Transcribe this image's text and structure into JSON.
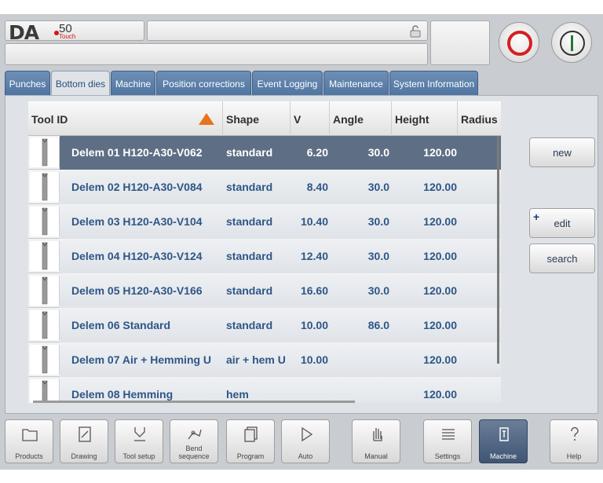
{
  "header": {
    "logo_brand": "DA",
    "logo_model": "50",
    "logo_sub": "Touch"
  },
  "tabs": [
    {
      "label": "Punches",
      "active": false
    },
    {
      "label": "Bottom dies",
      "active": true
    },
    {
      "label": "Machine",
      "active": false
    },
    {
      "label": "Position corrections",
      "active": false
    },
    {
      "label": "Event Logging",
      "active": false
    },
    {
      "label": "Maintenance",
      "active": false
    },
    {
      "label": "System Information",
      "active": false
    }
  ],
  "table": {
    "columns": [
      "Tool ID",
      "Shape",
      "V",
      "Angle",
      "Height",
      "Radius"
    ],
    "sort_column": "Tool ID",
    "rows": [
      {
        "id": "Delem 01 H120-A30-V062",
        "shape": "standard",
        "v": "6.20",
        "angle": "30.0",
        "height": "120.00",
        "radius": "",
        "selected": true
      },
      {
        "id": "Delem 02 H120-A30-V084",
        "shape": "standard",
        "v": "8.40",
        "angle": "30.0",
        "height": "120.00",
        "radius": ""
      },
      {
        "id": "Delem 03 H120-A30-V104",
        "shape": "standard",
        "v": "10.40",
        "angle": "30.0",
        "height": "120.00",
        "radius": ""
      },
      {
        "id": "Delem 04 H120-A30-V124",
        "shape": "standard",
        "v": "12.40",
        "angle": "30.0",
        "height": "120.00",
        "radius": ""
      },
      {
        "id": "Delem 05 H120-A30-V166",
        "shape": "standard",
        "v": "16.60",
        "angle": "30.0",
        "height": "120.00",
        "radius": ""
      },
      {
        "id": "Delem 06 Standard",
        "shape": "standard",
        "v": "10.00",
        "angle": "86.0",
        "height": "120.00",
        "radius": ""
      },
      {
        "id": "Delem 07 Air + Hemming U",
        "shape": "air + hem U",
        "v": "10.00",
        "angle": "",
        "height": "120.00",
        "radius": ""
      },
      {
        "id": "Delem 08 Hemming",
        "shape": "hem",
        "v": "",
        "angle": "",
        "height": "120.00",
        "radius": ""
      }
    ]
  },
  "side_buttons": {
    "new": "new",
    "edit": "edit",
    "edit_plus": "+",
    "search": "search"
  },
  "bottom_bar": [
    {
      "label": "Products",
      "icon": "folder-icon"
    },
    {
      "label": "Drawing",
      "icon": "drawing-icon"
    },
    {
      "label": "Tool setup",
      "icon": "tool-setup-icon"
    },
    {
      "label": "Bend sequence",
      "icon": "bend-sequence-icon"
    },
    {
      "label": "Program",
      "icon": "program-icon"
    },
    {
      "label": "Auto",
      "icon": "play-icon"
    },
    {
      "label": "Manual",
      "icon": "hand-icon"
    },
    {
      "label": "Settings",
      "icon": "settings-list-icon"
    },
    {
      "label": "Machine",
      "icon": "machine-icon",
      "active": true
    },
    {
      "label": "Help",
      "icon": "question-icon"
    }
  ],
  "colors": {
    "accent": "#5e6f85",
    "tab": "#5b7fae",
    "stop": "#d42020",
    "start": "#1f7a3a",
    "sort_arrow": "#e8731a"
  }
}
